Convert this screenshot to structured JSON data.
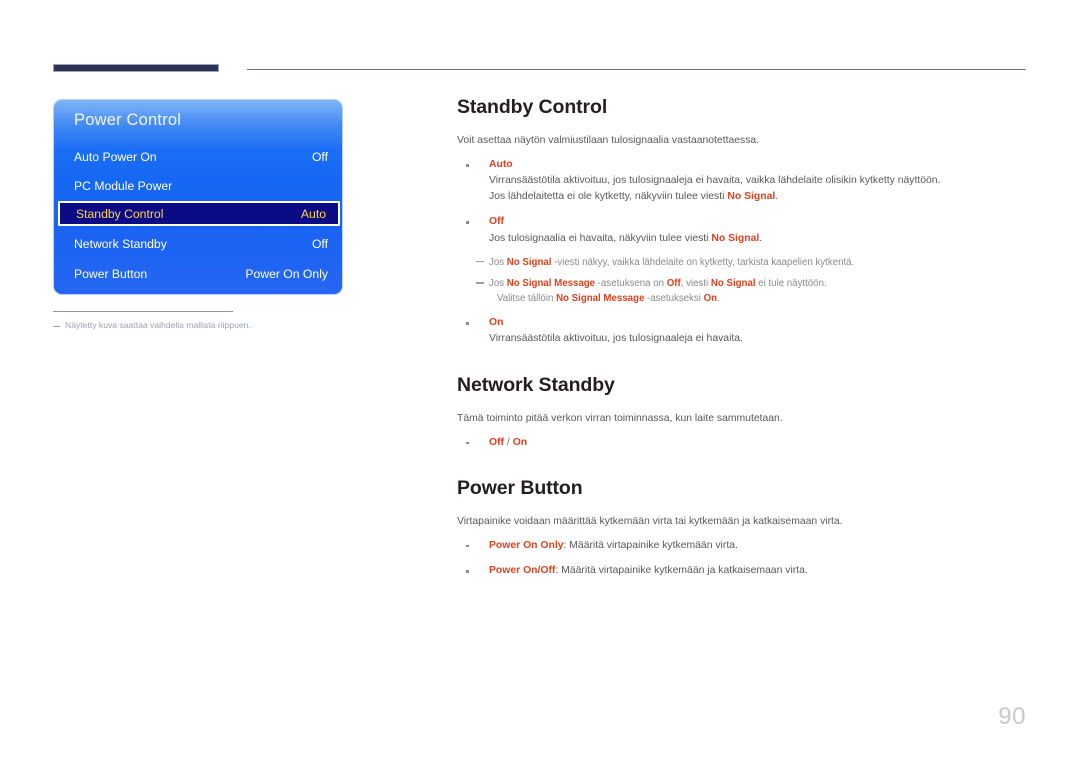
{
  "page": {
    "number": "90"
  },
  "osd": {
    "title": "Power Control",
    "rows": [
      {
        "label": "Auto Power On",
        "value": "Off",
        "selected": false
      },
      {
        "label": "PC Module Power",
        "value": "",
        "selected": false
      },
      {
        "label": "Standby Control",
        "value": "Auto",
        "selected": true
      },
      {
        "label": "Network Standby",
        "value": "Off",
        "selected": false
      },
      {
        "label": "Power Button",
        "value": "Power On Only",
        "selected": false
      }
    ],
    "note": "Näytetty kuva saattaa vaihdella mallista riippuen."
  },
  "sections": {
    "standby_control": {
      "title": "Standby Control",
      "lead": "Voit asettaa näytön valmiustilaan tulosignaalia vastaanotettaessa.",
      "items": {
        "auto": {
          "term": "Auto",
          "line1": "Virransäästötila aktivoituu, jos tulosignaaleja ei havaita, vaikka lähdelaite olisikin kytketty näyttöön.",
          "line2_a": "Jos lähdelaitetta ei ole kytketty, näkyviin tulee viesti ",
          "line2_term": "No Signal",
          "line2_b": "."
        },
        "off": {
          "term": "Off",
          "line1_a": "Jos tulosignaalia ei havaita, näkyviin tulee viesti ",
          "line1_term": "No Signal",
          "line1_b": "."
        },
        "on": {
          "term": "On",
          "line1": "Virransäästötila aktivoituu, jos tulosignaaleja ei havaita."
        }
      },
      "notes": {
        "note1": {
          "a": "Jos ",
          "term1": "No Signal",
          "b": " -viesti näkyy, vaikka lähdelaite on kytketty, tarkista kaapelien kytkentä."
        },
        "note2": {
          "a": "Jos ",
          "term1": "No Signal Message",
          "b": " -asetuksena on ",
          "term2": "Off",
          "c": ", viesti ",
          "term3": "No Signal",
          "d": " ei tule näyttöön.",
          "cont_a": "Valitse tällöin ",
          "cont_term": "No Signal Message",
          "cont_b": " -asetukseksi ",
          "cont_term2": "On",
          "cont_c": "."
        }
      }
    },
    "network_standby": {
      "title": "Network Standby",
      "lead": "Tämä toiminto pitää verkon virran toiminnassa, kun laite sammutetaan.",
      "option_off": "Off",
      "option_sep": " / ",
      "option_on": "On"
    },
    "power_button": {
      "title": "Power Button",
      "lead": "Virtapainike voidaan määrittää kytkemään virta tai kytkemään ja katkaisemaan virta.",
      "items": [
        {
          "term": "Power On Only",
          "desc": ": Määritä virtapainike kytkemään virta."
        },
        {
          "term": "Power On/Off",
          "desc": ": Määritä virtapainike kytkemään ja katkaisemaan virta."
        }
      ]
    }
  },
  "colors": {
    "accent_term": "#e0401c",
    "osd_blue": "#1667f4",
    "osd_selected_bg": "#0b0b86",
    "osd_selected_text": "#ffd64a",
    "rule_navy": "#2d3354"
  }
}
